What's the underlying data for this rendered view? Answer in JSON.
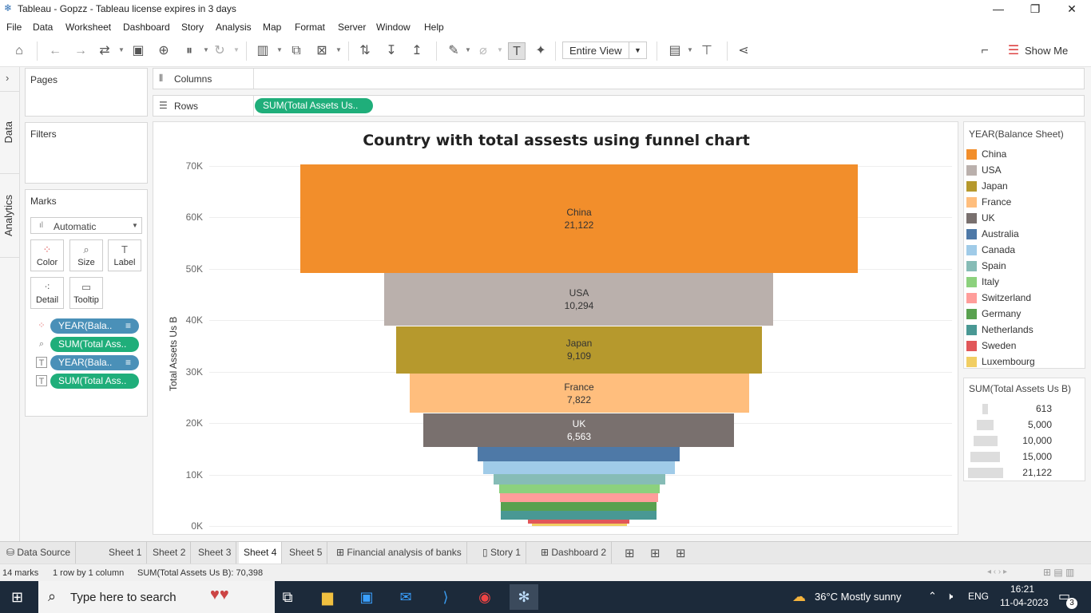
{
  "window": {
    "title": "Tableau - Gopzz - Tableau license expires in 3 days",
    "minimize": "—",
    "restore": "❐",
    "close": "✕"
  },
  "menu": [
    "File",
    "Data",
    "Worksheet",
    "Dashboard",
    "Story",
    "Analysis",
    "Map",
    "Format",
    "Server",
    "Window",
    "Help"
  ],
  "toolbar": {
    "fit_label": "Entire View",
    "show_me_label": "Show Me"
  },
  "sidebar_tabs": {
    "data": "Data",
    "analytics": "Analytics"
  },
  "panels": {
    "pages": "Pages",
    "filters": "Filters",
    "marks": "Marks",
    "mark_type": "Automatic",
    "mark_buttons": [
      "Color",
      "Size",
      "Label",
      "Detail",
      "Tooltip"
    ],
    "mark_pills": [
      "YEAR(Bala..",
      "SUM(Total Ass..",
      "YEAR(Bala..",
      "SUM(Total Ass.."
    ]
  },
  "shelves": {
    "columns_label": "Columns",
    "rows_label": "Rows",
    "rows_pill": "SUM(Total Assets Us.."
  },
  "chart_data": {
    "type": "bar",
    "title": "Country with total assests using funnel chart",
    "ylabel": "Total Assets Us B",
    "ylim": [
      0,
      70398
    ],
    "y_ticks": [
      {
        "label": "70K",
        "value": 70000
      },
      {
        "label": "60K",
        "value": 60000
      },
      {
        "label": "50K",
        "value": 50000
      },
      {
        "label": "40K",
        "value": 40000
      },
      {
        "label": "30K",
        "value": 30000
      },
      {
        "label": "20K",
        "value": 20000
      },
      {
        "label": "10K",
        "value": 10000
      },
      {
        "label": "0K",
        "value": 0
      }
    ],
    "series": [
      {
        "name": "China",
        "value": 21122,
        "label": "21,122",
        "color": "#f28e2b"
      },
      {
        "name": "USA",
        "value": 10294,
        "label": "10,294",
        "color": "#bab0ac"
      },
      {
        "name": "Japan",
        "value": 9109,
        "label": "9,109",
        "color": "#b6992d"
      },
      {
        "name": "France",
        "value": 7822,
        "label": "7,822",
        "color": "#ffbe7d"
      },
      {
        "name": "UK",
        "value": 6563,
        "label": "6,563",
        "color": "#79706e"
      },
      {
        "name": "Australia",
        "value": 2780,
        "label": "",
        "color": "#4e79a7"
      },
      {
        "name": "Canada",
        "value": 2500,
        "label": "",
        "color": "#a0cbe8"
      },
      {
        "name": "Spain",
        "value": 2000,
        "label": "",
        "color": "#86bcb6"
      },
      {
        "name": "Italy",
        "value": 1750,
        "label": "",
        "color": "#8cd17d"
      },
      {
        "name": "Switzerland",
        "value": 1700,
        "label": "",
        "color": "#ff9d9a"
      },
      {
        "name": "Germany",
        "value": 1650,
        "label": "",
        "color": "#59a14f"
      },
      {
        "name": "Netherlands",
        "value": 1650,
        "label": "",
        "color": "#499894"
      },
      {
        "name": "Sweden",
        "value": 700,
        "label": "",
        "color": "#e15759"
      },
      {
        "name": "Luxembourg",
        "value": 613,
        "label": "",
        "color": "#f1ce63"
      }
    ]
  },
  "legend_color": {
    "title": "YEAR(Balance Sheet)"
  },
  "legend_size": {
    "title": "SUM(Total Assets Us B)",
    "entries": [
      {
        "label": "613",
        "value": 613
      },
      {
        "label": "5,000",
        "value": 5000
      },
      {
        "label": "10,000",
        "value": 10000
      },
      {
        "label": "15,000",
        "value": 15000
      },
      {
        "label": "21,122",
        "value": 21122
      }
    ]
  },
  "sheet_tabs": [
    "Data Source",
    "Sheet 1",
    "Sheet 2",
    "Sheet 3",
    "Sheet 4",
    "Sheet 5",
    "Financial analysis of banks",
    "Story 1",
    "Dashboard 2"
  ],
  "status": {
    "marks": "14 marks",
    "dims": "1 row by 1 column",
    "sum": "SUM(Total Assets Us B): 70,398"
  },
  "taskbar": {
    "search_placeholder": "Type here to search",
    "weather": "36°C  Mostly sunny",
    "lang": "ENG",
    "time": "16:21",
    "date": "11-04-2023",
    "notifications": "3"
  }
}
